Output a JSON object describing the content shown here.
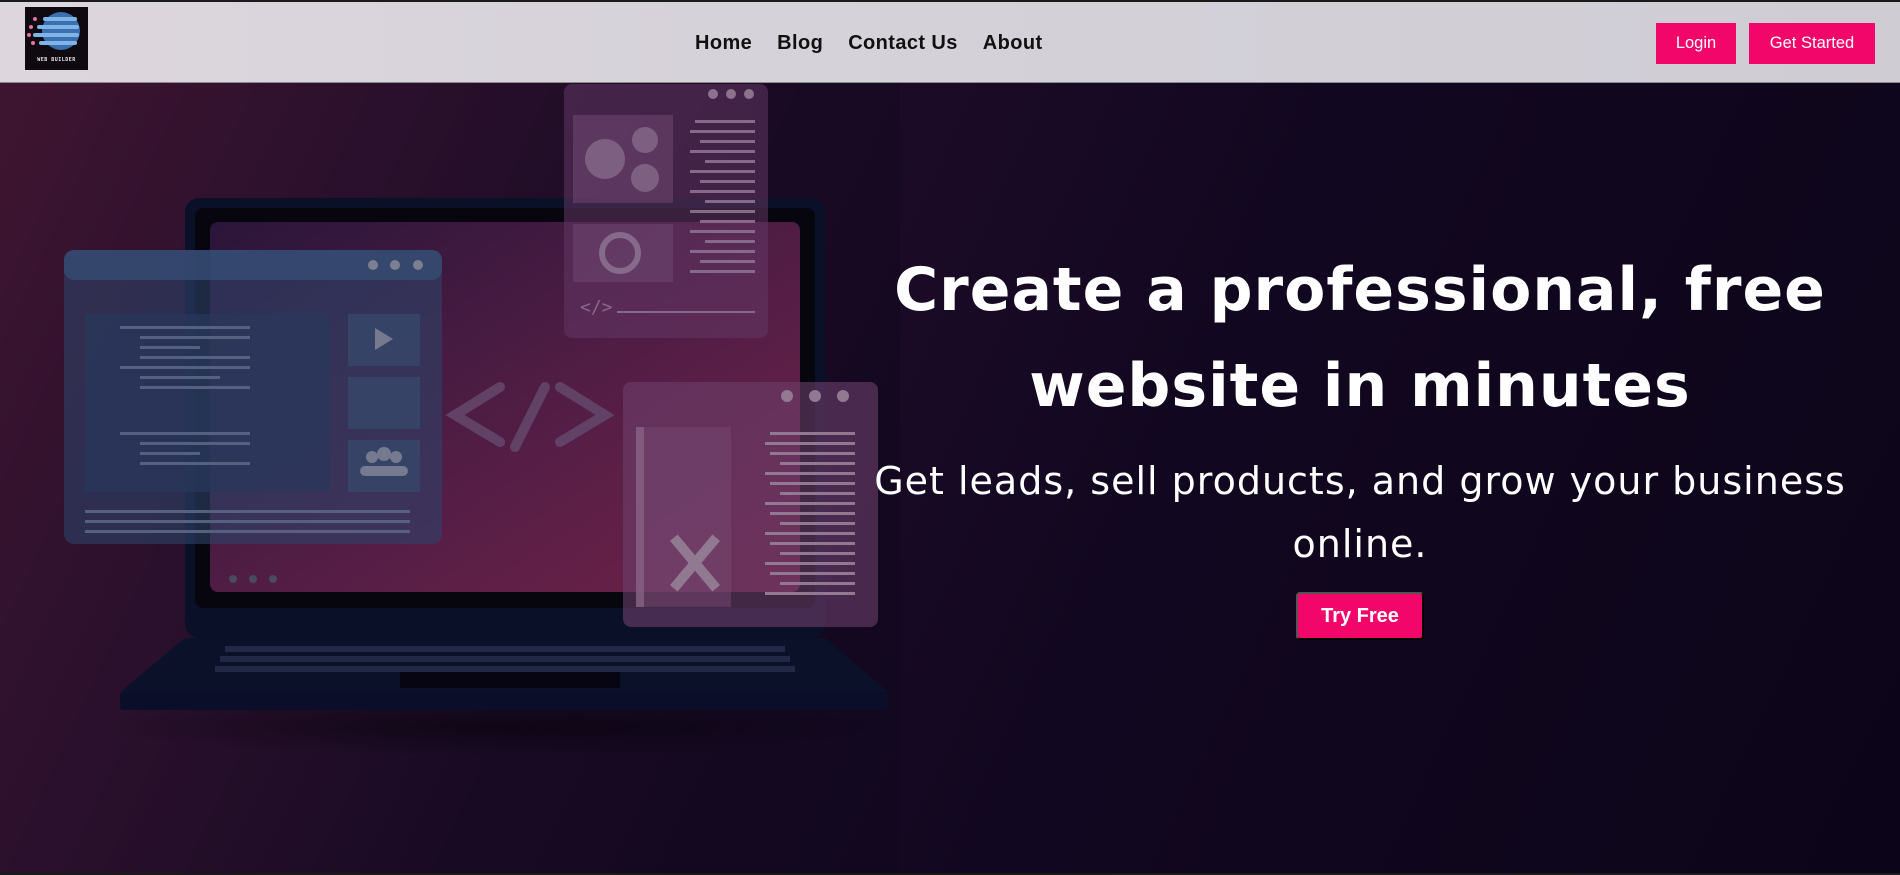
{
  "header": {
    "logo_text": "WEB BUILDER",
    "nav": [
      "Home",
      "Blog",
      "Contact Us",
      "About"
    ],
    "login_label": "Login",
    "get_started_label": "Get Started"
  },
  "hero": {
    "title_line1": "Create a professional, free",
    "title_line2": "website in minutes",
    "subtitle_line1": "Get leads, sell products, and grow your business",
    "subtitle_line2": "online.",
    "cta_label": "Try Free"
  },
  "colors": {
    "accent": "#f2066a",
    "navbar_bg": "#d6d2da",
    "hero_bg_dark": "#0c0519",
    "hero_bg_magenta": "#5a1d3e"
  }
}
